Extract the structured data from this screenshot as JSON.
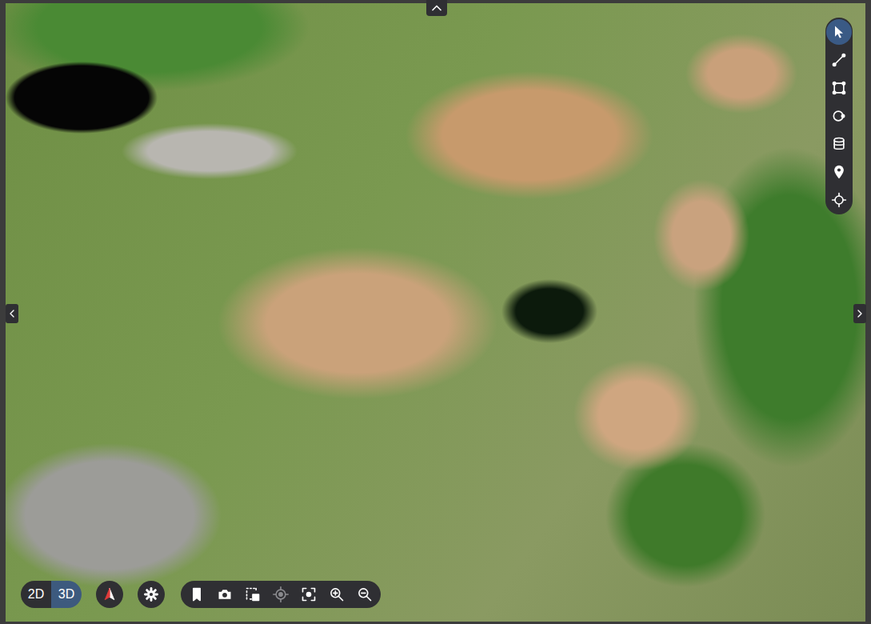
{
  "tools": [
    {
      "kind": "select",
      "selected": true
    },
    {
      "kind": "distance",
      "selected": false
    },
    {
      "kind": "area",
      "selected": false
    },
    {
      "kind": "circle",
      "selected": false
    },
    {
      "kind": "volume",
      "selected": false
    },
    {
      "kind": "marker",
      "selected": false
    },
    {
      "kind": "point",
      "selected": false
    }
  ],
  "view_modes": [
    {
      "label": "2D",
      "selected": false
    },
    {
      "label": "3D",
      "selected": true
    }
  ],
  "controls": [
    {
      "kind": "bookmark",
      "disabled": false
    },
    {
      "kind": "camera",
      "disabled": false
    },
    {
      "kind": "capture",
      "disabled": false
    },
    {
      "kind": "locate",
      "disabled": true
    },
    {
      "kind": "focus",
      "disabled": false
    },
    {
      "kind": "zoom-in",
      "disabled": false
    },
    {
      "kind": "zoom-out",
      "disabled": false
    }
  ]
}
